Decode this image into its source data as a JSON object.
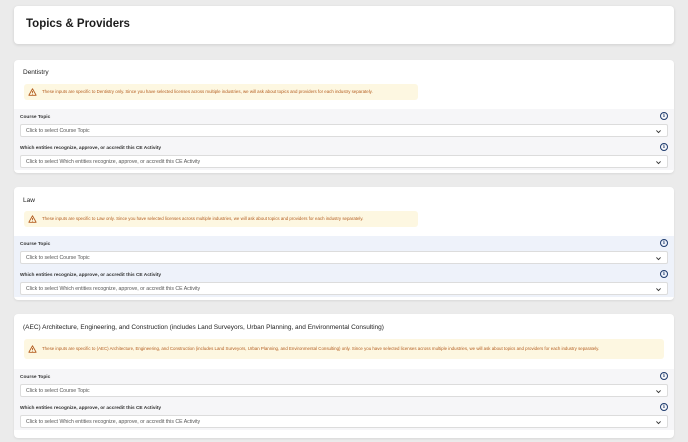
{
  "page": {
    "title": "Topics & Providers"
  },
  "sections": [
    {
      "title": "Dentistry",
      "warning": "These inputs are specific to Dentistry only. Since you have selected licenses across multiple industries, we will ask about topics and providers for each industry separately.",
      "fields": [
        {
          "label": "Course Topic",
          "placeholder": "Click to select Course Topic"
        },
        {
          "label": "Which entities recognize, approve, or accredit this CE Activity",
          "placeholder": "Click to select Which entities recognize, approve, or accredit this CE Activity"
        }
      ]
    },
    {
      "title": "Law",
      "warning": "These inputs are specific to Law only. Since you have selected licenses across multiple industries, we will ask about topics and providers for each industry separately.",
      "fields": [
        {
          "label": "Course Topic",
          "placeholder": "Click to select Course Topic"
        },
        {
          "label": "Which entities recognize, approve, or accredit this CE Activity",
          "placeholder": "Click to select Which entities recognize, approve, or accredit this CE Activity"
        }
      ]
    },
    {
      "title": "(AEC) Architecture, Engineering, and Construction (includes Land Surveyors, Urban Planning, and Environmental Consulting)",
      "warning": "These inputs are specific to (AEC) Architecture, Engineering, and Construction (includes Land Surveyors, Urban Planning, and Environmental Consulting) only. Since you have selected licenses across multiple industries, we will ask about topics and providers for each industry separately.",
      "fields": [
        {
          "label": "Course Topic",
          "placeholder": "Click to select Course Topic"
        },
        {
          "label": "Which entities recognize, approve, or accredit this CE Activity",
          "placeholder": "Click to select Which entities recognize, approve, or accredit this CE Activity"
        }
      ]
    }
  ],
  "icons": {
    "warning": "warning-triangle-icon",
    "info": "info-icon",
    "dropdown": "chevron-down-icon"
  },
  "colors": {
    "warning_bg": "#fdf7e1",
    "warning_text": "#b35c1e",
    "info": "#1f3c6e"
  }
}
